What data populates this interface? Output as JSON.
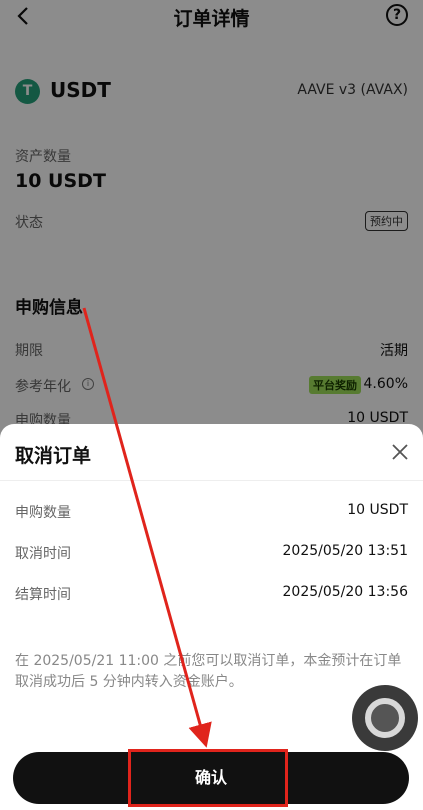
{
  "header": {
    "title": "订单详情",
    "back_icon": "chevron-left-icon",
    "help_icon": "question-circle-icon",
    "help_glyph": "?"
  },
  "asset": {
    "coin_icon_glyph": "T",
    "coin_name": "USDT",
    "protocol": "AAVE v3 (AVAX)",
    "amount_label": "资产数量",
    "amount_value": "10 USDT",
    "status_label": "状态",
    "status_badge": "预约中"
  },
  "subscription": {
    "section_title": "申购信息",
    "term_label": "期限",
    "term_value": "活期",
    "apr_label": "参考年化",
    "apr_info_glyph": "i",
    "reward_badge": "平台奖励",
    "apr_value": "4.60%",
    "sub_amount_label": "申购数量",
    "sub_amount_value": "10 USDT"
  },
  "sheet": {
    "title": "取消订单",
    "close_icon": "close-icon",
    "rows": [
      {
        "label": "申购数量",
        "value": "10 USDT"
      },
      {
        "label": "取消时间",
        "value": "2025/05/20 13:51"
      },
      {
        "label": "结算时间",
        "value": "2025/05/20 13:56"
      }
    ],
    "note": "在 2025/05/21 11:00 之前您可以取消订单，本金预计在订单取消成功后 5 分钟内转入资金账户。",
    "confirm_label": "确认"
  },
  "colors": {
    "accent": "#111111",
    "tether_green": "#26a17b",
    "reward_green": "#9ee05a",
    "annotation_red": "#e0241c"
  }
}
